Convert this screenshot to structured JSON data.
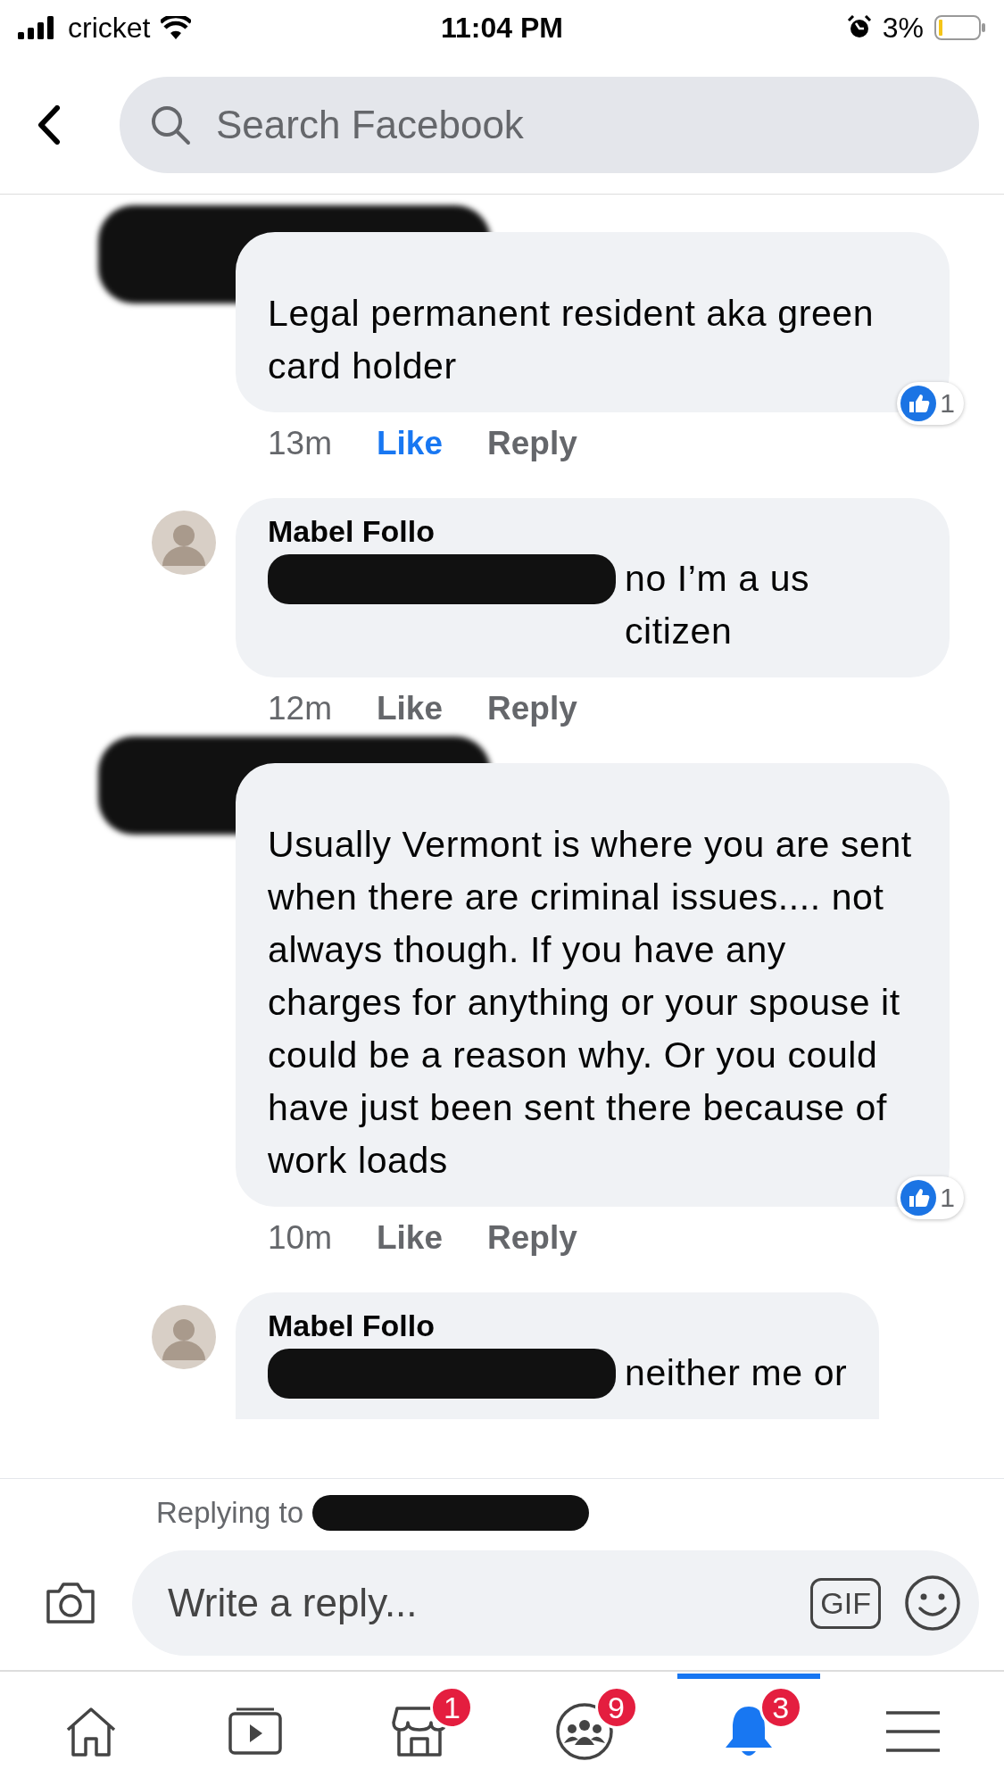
{
  "status_bar": {
    "carrier": "cricket",
    "time": "11:04 PM",
    "battery": "3%"
  },
  "search": {
    "placeholder": "Search Facebook"
  },
  "comments": [
    {
      "author_redacted": true,
      "mention_redacted": false,
      "text": "Legal permanent resident aka green card holder",
      "time": "13m",
      "like": "Like",
      "liked": true,
      "reply": "Reply",
      "reactions": "1",
      "bubble_cut": false
    },
    {
      "author": "Mabel Follo",
      "author_redacted": false,
      "mention_redacted": true,
      "text": "no I’m a us citizen",
      "time": "12m",
      "like": "Like",
      "liked": false,
      "reply": "Reply",
      "bubble_cut": false
    },
    {
      "author_redacted": true,
      "mention_redacted": false,
      "text": "Usually Vermont is where you are sent when there are criminal issues.... not always though. If you have any charges for anything or your spouse it could be a reason why. Or you could have just been sent there because of work loads",
      "time": "10m",
      "like": "Like",
      "liked": false,
      "reply": "Reply",
      "reactions": "1",
      "bubble_cut": false
    },
    {
      "author": "Mabel Follo",
      "author_redacted": false,
      "mention_redacted": true,
      "text": "neither me or",
      "bubble_cut": true
    }
  ],
  "reply_bar": {
    "replying_to": "Replying to",
    "target_redacted": true,
    "placeholder": "Write a reply...",
    "gif_label": "GIF"
  },
  "tabs": [
    {
      "kind": "home",
      "selected": false
    },
    {
      "kind": "video",
      "selected": false
    },
    {
      "kind": "marketplace",
      "selected": false,
      "badge": "1"
    },
    {
      "kind": "groups",
      "selected": false,
      "badge": "9"
    },
    {
      "kind": "notifications",
      "selected": true,
      "badge": "3"
    },
    {
      "kind": "menu",
      "selected": false
    }
  ]
}
